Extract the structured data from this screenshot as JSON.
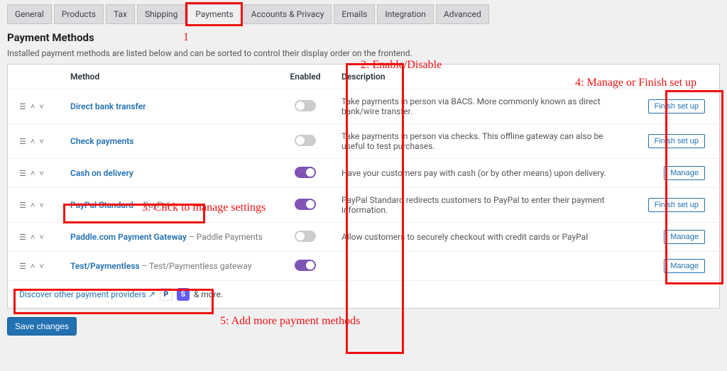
{
  "tabs": [
    "General",
    "Products",
    "Tax",
    "Shipping",
    "Payments",
    "Accounts & Privacy",
    "Emails",
    "Integration",
    "Advanced"
  ],
  "active_tab_index": 4,
  "heading": "Payment Methods",
  "subheading": "Installed payment methods are listed below and can be sorted to control their display order on the frontend.",
  "columns": {
    "method": "Method",
    "enabled": "Enabled",
    "description": "Description"
  },
  "rows": [
    {
      "name": "Direct bank transfer",
      "sub": "",
      "enabled": false,
      "desc": "Take payments in person via BACS. More commonly known as direct bank/wire transfer.",
      "action": "Finish set up"
    },
    {
      "name": "Check payments",
      "sub": "",
      "enabled": false,
      "desc": "Take payments in person via checks. This offline gateway can also be useful to test purchases.",
      "action": "Finish set up"
    },
    {
      "name": "Cash on delivery",
      "sub": "",
      "enabled": true,
      "desc": "Have your customers pay with cash (or by other means) upon delivery.",
      "action": "Manage"
    },
    {
      "name": "PayPal Standard",
      "sub": " – PayPal",
      "enabled": true,
      "desc": "PayPal Standard redirects customers to PayPal to enter their payment information.",
      "action": "Finish set up"
    },
    {
      "name": "Paddle.com Payment Gateway",
      "sub": " – Paddle Payments",
      "enabled": false,
      "desc": "Allow customers to securely checkout with credit cards or PayPal",
      "action": "Manage"
    },
    {
      "name": "Test/Paymentless",
      "sub": " – Test/Paymentless gateway",
      "enabled": true,
      "desc": "",
      "action": "Manage"
    }
  ],
  "discover": {
    "link": "Discover other payment providers",
    "more": "& more."
  },
  "save_label": "Save changes",
  "annotations": {
    "a1": "1",
    "a2": "2: Enable/Disable",
    "a3": "3: Click to manage settings",
    "a4": "4: Manage or Finish set up",
    "a5": "5: Add more payment methods"
  }
}
